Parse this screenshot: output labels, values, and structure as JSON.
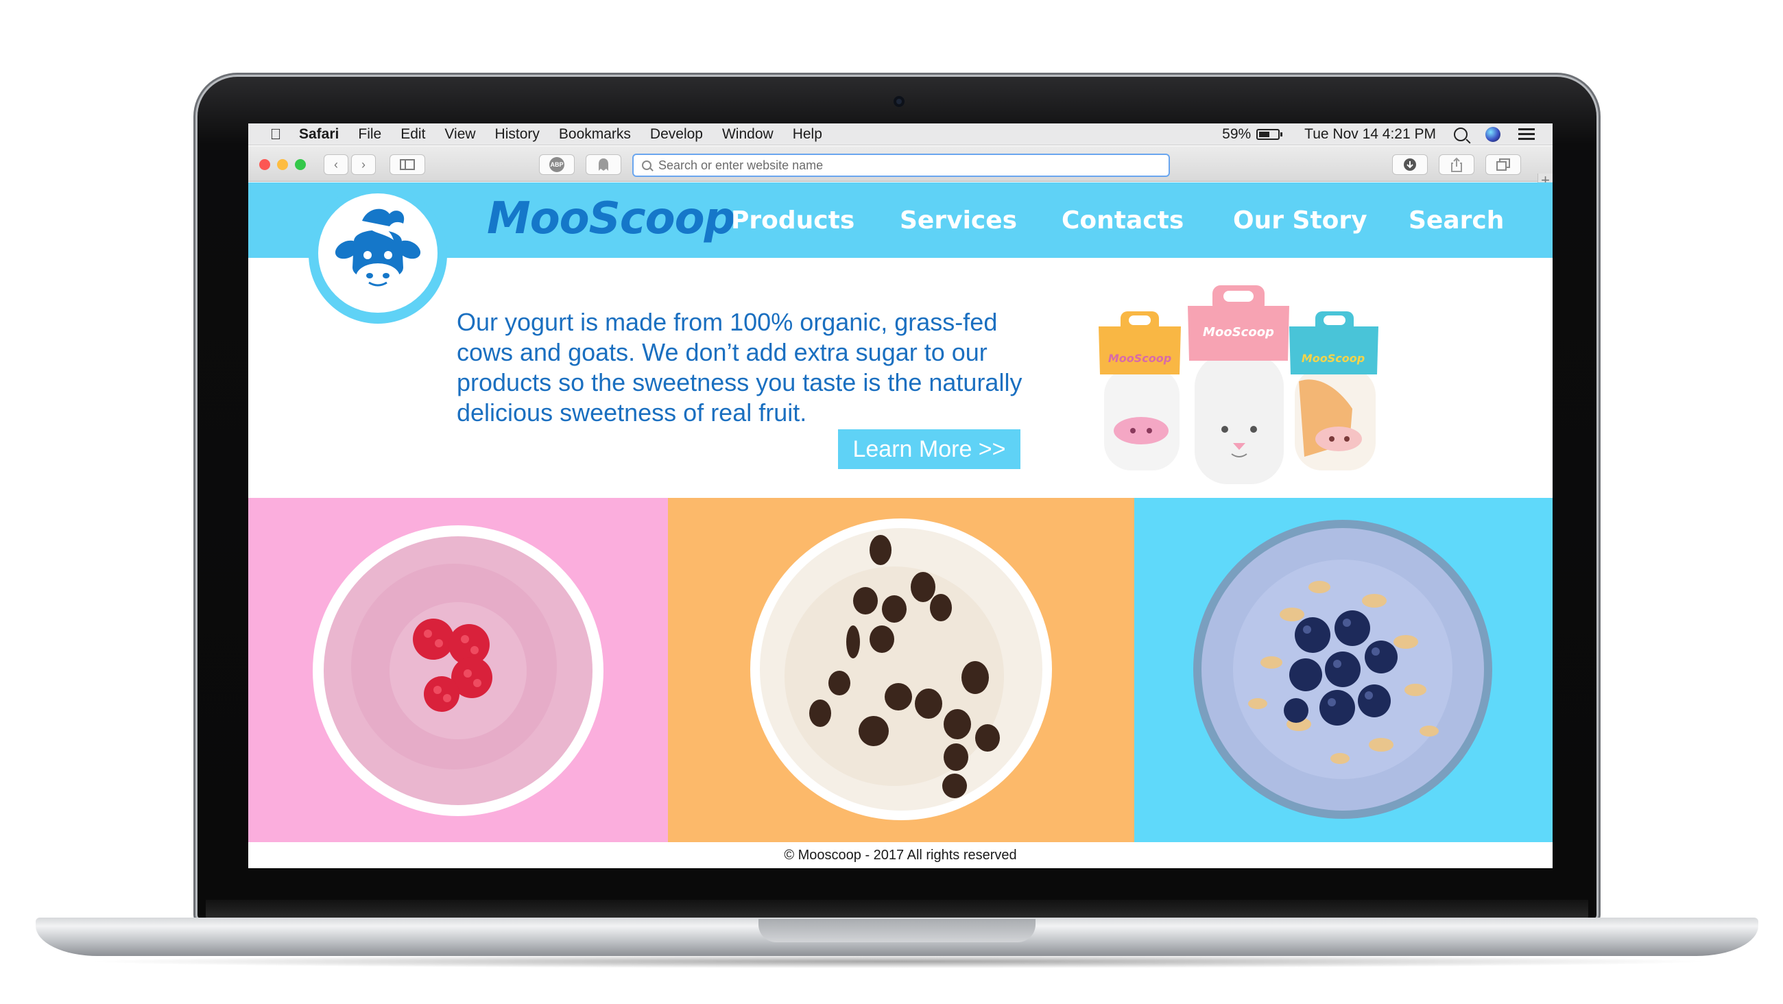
{
  "menubar": {
    "apple_icon": "apple-logo-icon",
    "items": [
      "Safari",
      "File",
      "Edit",
      "View",
      "History",
      "Bookmarks",
      "Develop",
      "Window",
      "Help"
    ],
    "battery_percent": "59%",
    "battery_level": 0.59,
    "datetime": "Tue Nov 14  4:21 PM"
  },
  "safari": {
    "address_placeholder": "Search or enter website name",
    "adblock_label": "ABP"
  },
  "site": {
    "brand": "MooScoop",
    "nav": [
      "Products",
      "Services",
      "Contacts",
      "Our Story",
      "Search"
    ],
    "hero_text": "Our yogurt is made from 100% organic, grass-fed cows and goats. We don’t add extra sugar to our products so the sweetness you taste is the naturally delicious sweetness of real fruit.",
    "cta_label": "Learn More >>",
    "bottle_labels": [
      "MooScoop",
      "MooScoop",
      "MooScoop"
    ],
    "footer": "© Mooscoop - 2017 All rights reserved"
  },
  "colors": {
    "header_bg": "#5fd2f6",
    "brand_blue": "#1577c9",
    "text_blue": "#1a6fc0",
    "tile_pink": "#fbaedd",
    "tile_orange": "#fcb96a",
    "tile_blue": "#5fd9fa"
  }
}
